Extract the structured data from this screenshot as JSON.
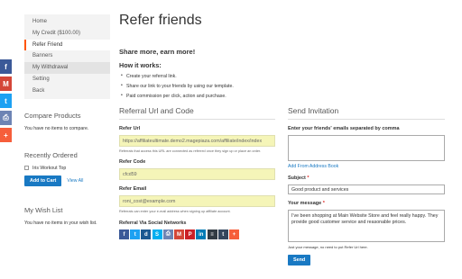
{
  "float_share": [
    {
      "icon": "facebook-icon",
      "glyph": "f",
      "color": "#3b5998"
    },
    {
      "icon": "gmail-icon",
      "glyph": "M",
      "color": "#d44638"
    },
    {
      "icon": "twitter-icon",
      "glyph": "t",
      "color": "#1da1f2"
    },
    {
      "icon": "print-icon",
      "glyph": "⎙",
      "color": "#6d84b4"
    },
    {
      "icon": "plus-icon",
      "glyph": "+",
      "color": "#f65e3b"
    }
  ],
  "sidebar": {
    "nav": [
      {
        "label": "Home",
        "state": "normal"
      },
      {
        "label": "My Credit ($100.00)",
        "state": "normal"
      },
      {
        "label": "Refer Friend",
        "state": "active"
      },
      {
        "label": "Banners",
        "state": "normal"
      },
      {
        "label": "My Withdrawal",
        "state": "dark"
      },
      {
        "label": "Setting",
        "state": "normal"
      },
      {
        "label": "Back",
        "state": "normal"
      }
    ],
    "compare": {
      "title": "Compare Products",
      "text": "You have no items to compare."
    },
    "recent": {
      "title": "Recently Ordered",
      "item": "Iris Workout Top",
      "add_to_cart": "Add to Cart",
      "view_all": "View All"
    },
    "wishlist": {
      "title": "My Wish List",
      "text": "You have no items in your wish list."
    }
  },
  "main": {
    "title": "Refer friends",
    "tagline": "Share more, earn more!",
    "how_title": "How it works:",
    "how_items": [
      "Create your referral link.",
      "Share our link to your friends by using our template.",
      "Paid commission per click, action and purchase."
    ],
    "referral": {
      "title": "Referral Url and Code",
      "url_label": "Refer Url",
      "url_value": "https://affiliateultimate.demo2.magepiaza.com/affiliate/index/index",
      "url_note": "Referrals that access this URL are connected as referred once they sign up or place an order.",
      "code_label": "Refer Code",
      "code_value": "cfcd59",
      "email_label": "Refer Email",
      "email_value": "roni_cost@example.com",
      "email_note": "Referrals can enter your e-mail address when signing up affiliate account.",
      "social_label": "Referral Via Social Networks",
      "social": [
        {
          "icon": "facebook-icon",
          "glyph": "f",
          "color": "#3b5998"
        },
        {
          "icon": "twitter-icon",
          "glyph": "t",
          "color": "#1da1f2"
        },
        {
          "icon": "digg-icon",
          "glyph": "d",
          "color": "#1b5891"
        },
        {
          "icon": "skype-icon",
          "glyph": "S",
          "color": "#00aff0"
        },
        {
          "icon": "print-icon",
          "glyph": "⎙",
          "color": "#6d84b4"
        },
        {
          "icon": "gmail-icon",
          "glyph": "M",
          "color": "#d44638"
        },
        {
          "icon": "pinterest-icon",
          "glyph": "P",
          "color": "#cb2027"
        },
        {
          "icon": "linkedin-icon",
          "glyph": "in",
          "color": "#007bb5"
        },
        {
          "icon": "buffer-icon",
          "glyph": "≡",
          "color": "#323b43"
        },
        {
          "icon": "tumblr-icon",
          "glyph": "t",
          "color": "#35465c"
        },
        {
          "icon": "plus-icon",
          "glyph": "+",
          "color": "#f65e3b"
        }
      ]
    },
    "invite": {
      "title": "Send Invitation",
      "emails_label": "Enter your friends' emails separated by comma",
      "address_book": "Add From Address Book",
      "subject_label": "Subject",
      "subject_value": "Good product and services",
      "message_label": "Your message",
      "message_value": "I've been shopping at Main Website Store and feel really happy. They provide good customer service and reasonable prices.",
      "message_note": "Just your message, no need to put Refer Url here.",
      "send": "Send"
    }
  }
}
